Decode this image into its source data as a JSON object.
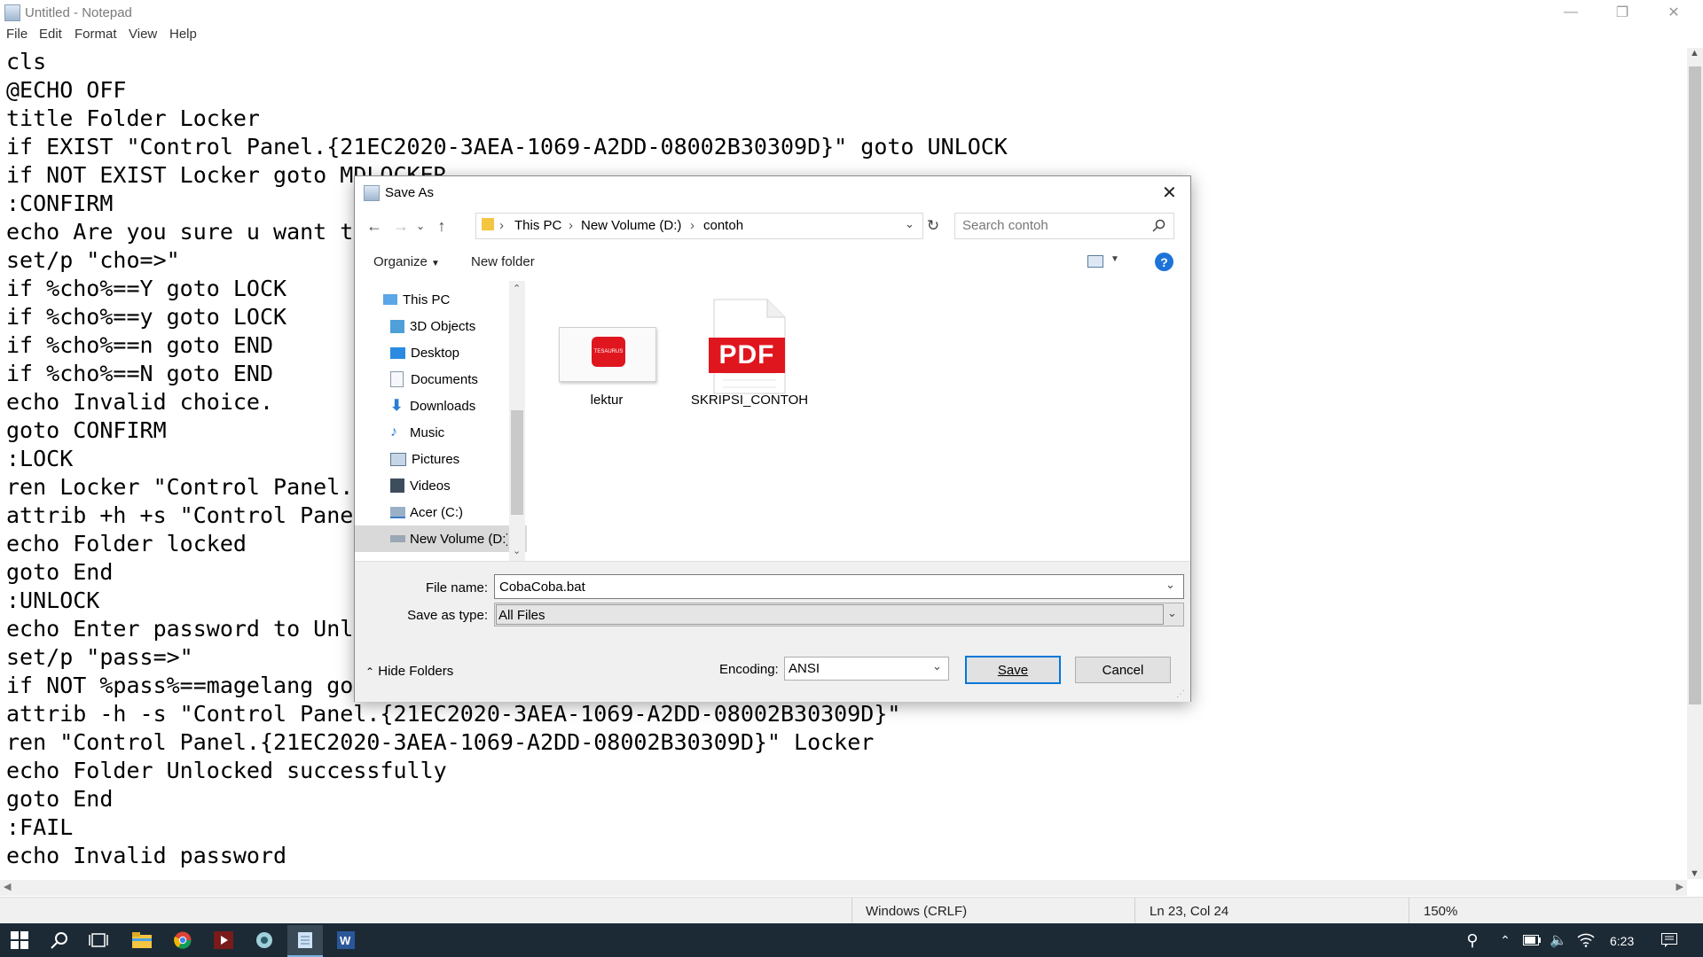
{
  "notepad": {
    "window_title": "Untitled - Notepad",
    "menu": [
      "File",
      "Edit",
      "Format",
      "View",
      "Help"
    ],
    "lines": [
      "cls",
      "@ECHO OFF",
      "title Folder Locker",
      "if EXIST \"Control Panel.{21EC2020-3AEA-1069-A2DD-08002B30309D}\" goto UNLOCK",
      "if NOT EXIST Locker goto MDLOCKER",
      ":CONFIRM",
      "echo Are you sure u want t",
      "set/p \"cho=>\"",
      "if %cho%==Y goto LOCK",
      "if %cho%==y goto LOCK",
      "if %cho%==n goto END",
      "if %cho%==N goto END",
      "echo Invalid choice.",
      "goto CONFIRM",
      ":LOCK",
      "ren Locker \"Control Panel.",
      "attrib +h +s \"Control Pane",
      "echo Folder locked",
      "goto End",
      ":UNLOCK",
      "echo Enter password to Unl",
      "set/p \"pass=>\"",
      "if NOT %pass%==magelang go",
      "attrib -h -s \"Control Panel.{21EC2020-3AEA-1069-A2DD-08002B30309D}\"",
      "ren \"Control Panel.{21EC2020-3AEA-1069-A2DD-08002B30309D}\" Locker",
      "echo Folder Unlocked successfully",
      "goto End",
      ":FAIL",
      "echo Invalid password"
    ],
    "status": {
      "line_ending": "Windows (CRLF)",
      "position": "Ln 23, Col 24",
      "zoom": "150%"
    }
  },
  "dialog": {
    "title": "Save As",
    "breadcrumb": [
      "This PC",
      "New Volume (D:)",
      "contoh"
    ],
    "search_placeholder": "Search contoh",
    "organize_label": "Organize",
    "new_folder_label": "New folder",
    "nav_items": [
      "This PC",
      "3D Objects",
      "Desktop",
      "Documents",
      "Downloads",
      "Music",
      "Pictures",
      "Videos",
      "Acer (C:)",
      "New Volume (D:)"
    ],
    "files": [
      {
        "name": "lektur",
        "thumb_text": "TESAURUS"
      },
      {
        "name": "SKRIPSI_CONTOH",
        "thumb_text": "PDF"
      }
    ],
    "file_name_label": "File name:",
    "file_name_value": "CobaCoba.bat",
    "save_type_label": "Save as type:",
    "save_type_value": "All Files",
    "hide_folders_label": "Hide Folders",
    "encoding_label": "Encoding:",
    "encoding_value": "ANSI",
    "save_label": "Save",
    "cancel_label": "Cancel"
  },
  "taskbar": {
    "time": "6:23"
  },
  "colors": {
    "taskbar_bg": "#1c2a36",
    "accent_blue": "#0078d7",
    "pdf_red": "#e0161f"
  }
}
